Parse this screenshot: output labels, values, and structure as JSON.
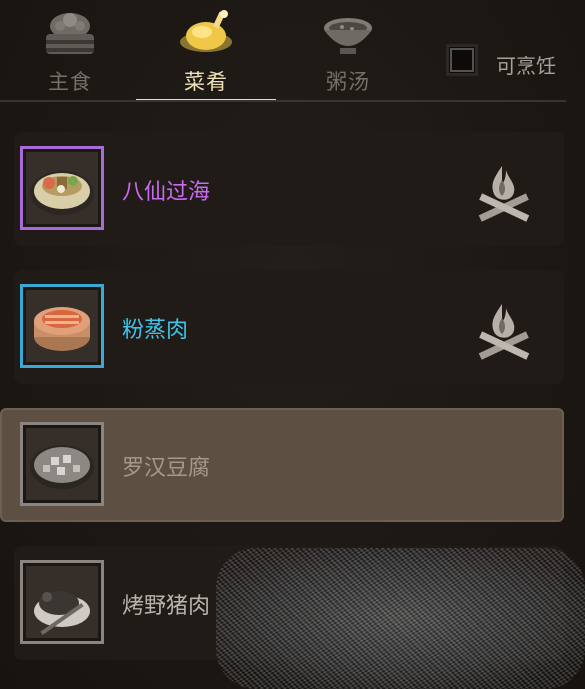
{
  "tabs": [
    {
      "label": "主食",
      "icon": "bun-steamer-icon",
      "active": false
    },
    {
      "label": "菜肴",
      "icon": "roast-chicken-icon",
      "active": true
    },
    {
      "label": "粥汤",
      "icon": "soup-bowl-icon",
      "active": false
    }
  ],
  "filter": {
    "label": "可烹饪",
    "checked": false
  },
  "dishes": [
    {
      "name": "八仙过海",
      "color": "#c86bf0",
      "frame_color": "#a86bd8",
      "icon": "seafood-platter-icon",
      "cook_icon": "campfire-icon",
      "selected": false
    },
    {
      "name": "粉蒸肉",
      "color": "#3fc3ea",
      "frame_color": "#3aa9d6",
      "icon": "steamed-pork-icon",
      "cook_icon": "campfire-icon",
      "selected": false
    },
    {
      "name": "罗汉豆腐",
      "color": "#a6998a",
      "frame_color": "#8a8580",
      "icon": "tofu-plate-icon",
      "cook_icon": "",
      "selected": true
    },
    {
      "name": "烤野猪肉",
      "color": "#b8b3ad",
      "frame_color": "#8a8580",
      "icon": "roast-boar-icon",
      "cook_icon": "",
      "selected": false
    }
  ],
  "colors": {
    "accent": "#e9dcb7",
    "background": "#1b1714"
  }
}
